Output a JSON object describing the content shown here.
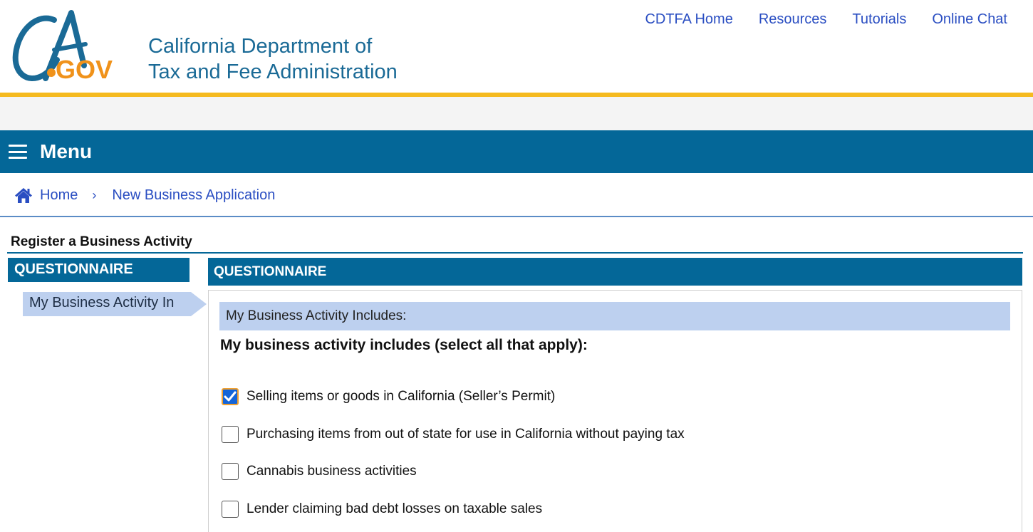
{
  "logo": {
    "ca_text": "CA",
    "gov_text": ".GOV"
  },
  "agency": {
    "line1": "California Department of",
    "line2": "Tax and Fee Administration"
  },
  "top_nav": [
    "CDTFA Home",
    "Resources",
    "Tutorials",
    "Online Chat"
  ],
  "menu": {
    "label": "Menu"
  },
  "breadcrumb": {
    "home": "Home",
    "separator": "›",
    "current": "New Business Application"
  },
  "page_title": "Register a Business Activity",
  "sidebar": {
    "heading": "QUESTIONNAIRE",
    "step": "My Business Activity In"
  },
  "main": {
    "heading": "QUESTIONNAIRE",
    "section": "My Business Activity Includes:",
    "question": "My business activity includes (select all that apply):",
    "options": [
      {
        "label": "Selling items or goods in California (Seller’s Permit)",
        "checked": true
      },
      {
        "label": "Purchasing items from out of state for use in California without paying tax",
        "checked": false
      },
      {
        "label": "Cannabis business activities",
        "checked": false
      },
      {
        "label": "Lender claiming bad debt losses on taxable sales",
        "checked": false
      }
    ]
  },
  "colors": {
    "brand_blue": "#046798",
    "gold": "#f5ba1f",
    "link_blue": "#2a4ec2",
    "light_blue": "#bdd0ef",
    "checkbox_checked": "#1565d8",
    "checkbox_focus": "#f0a030",
    "logo_orange": "#f0921a"
  }
}
